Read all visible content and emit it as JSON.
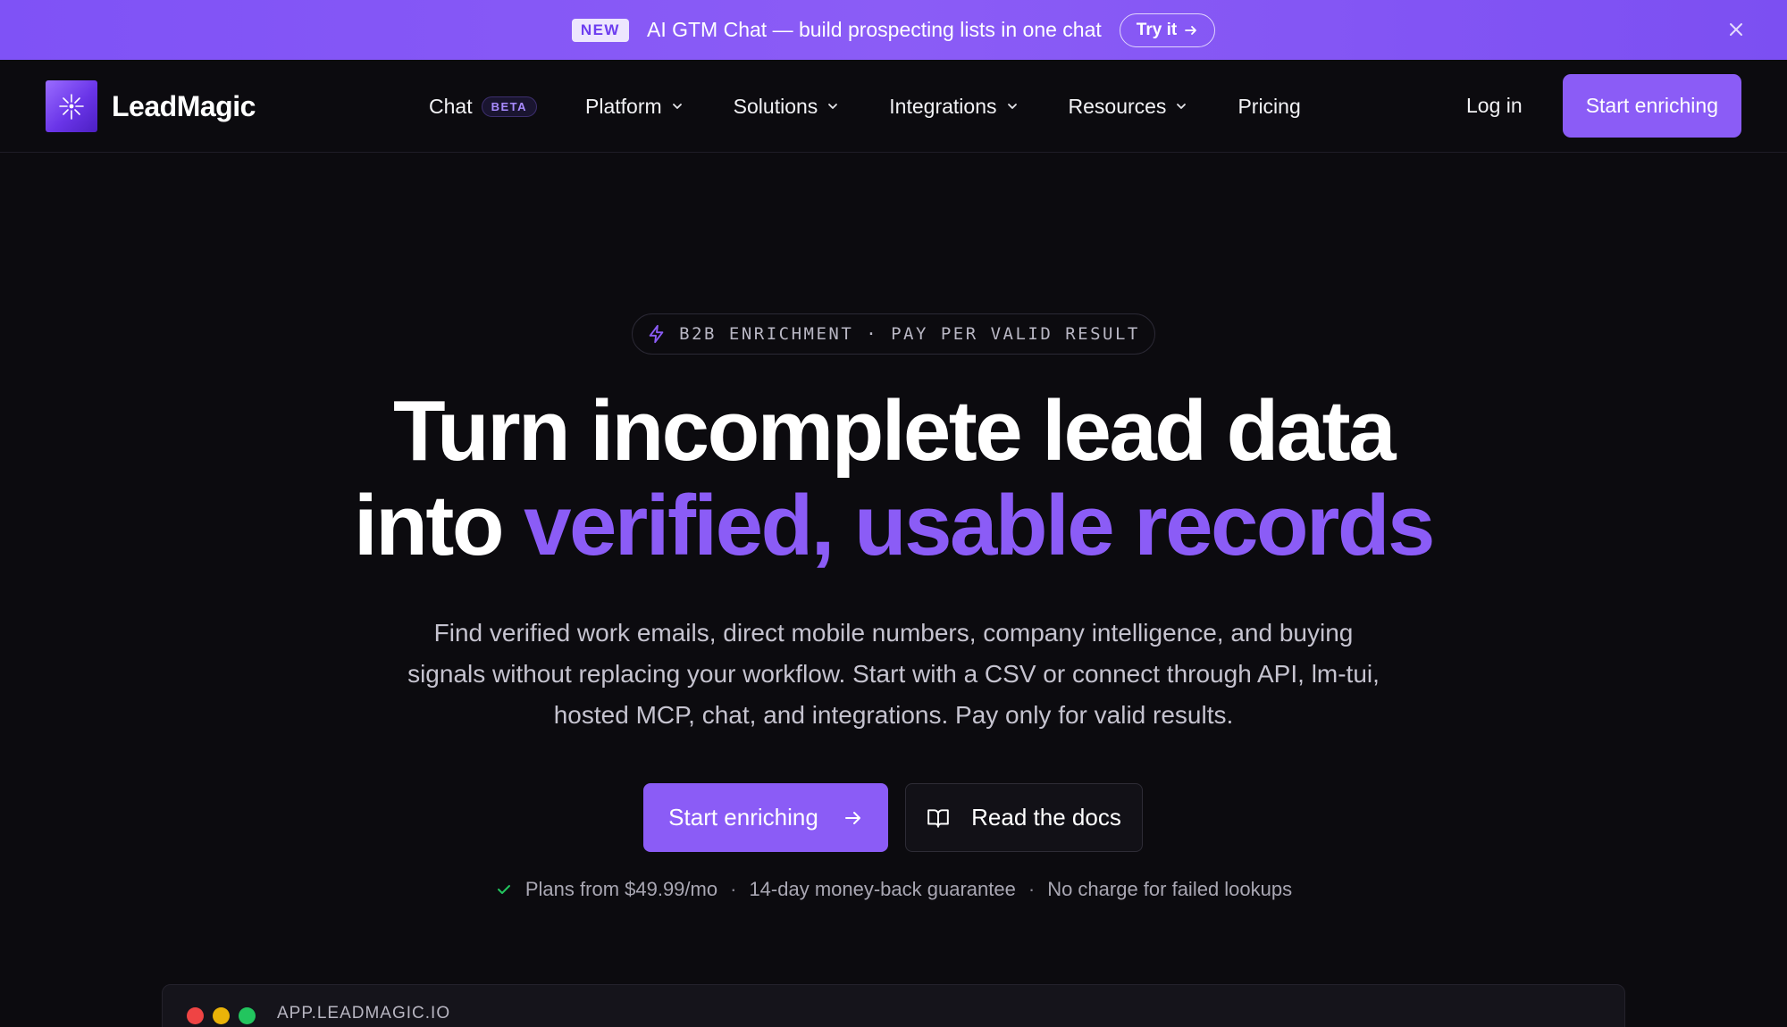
{
  "announcement": {
    "badge": "NEW",
    "message": "AI GTM Chat — build prospecting lists in one chat",
    "cta": "Try it",
    "icons": {
      "cta": "arrow-right-icon",
      "close": "close-icon"
    }
  },
  "nav": {
    "brand": "LeadMagic",
    "items": [
      {
        "label": "Chat",
        "badge": "BETA"
      },
      {
        "label": "Platform",
        "icon": "chevron-down-icon"
      },
      {
        "label": "Solutions",
        "icon": "chevron-down-icon"
      },
      {
        "label": "Integrations",
        "icon": "chevron-down-icon"
      },
      {
        "label": "Resources",
        "icon": "chevron-down-icon"
      },
      {
        "label": "Pricing"
      }
    ],
    "login": "Log in",
    "cta": "Start enriching"
  },
  "hero": {
    "pill": "B2B ENRICHMENT · PAY PER VALID RESULT",
    "pill_icon": "lightning-icon",
    "headline_line1": "Turn incomplete lead data",
    "headline_line2_plain": "into",
    "headline_line2_accent": "verified, usable records",
    "subtitle": "Find verified work emails, direct mobile numbers, company intelligence, and buying signals without replacing your workflow. Start with a CSV or connect through API, lm-tui, hosted MCP, chat, and integrations. Pay only for valid results.",
    "primary_cta": "Start enriching",
    "secondary_cta": "Read the docs",
    "perks": [
      "Plans from $49.99/mo",
      "14-day money-back guarantee",
      "No charge for failed lookups"
    ],
    "perk_icon": "check-icon",
    "perk_separator": "·"
  },
  "app_window": {
    "url": "APP.LEADMAGIC.IO"
  },
  "colors": {
    "accent": "#8b5cf6",
    "background": "#0c0b0f",
    "announce_bar": "#8057f5",
    "check": "#22c55e",
    "traffic_red": "#ef4444",
    "traffic_yellow": "#eab308",
    "traffic_green": "#22c55e"
  }
}
